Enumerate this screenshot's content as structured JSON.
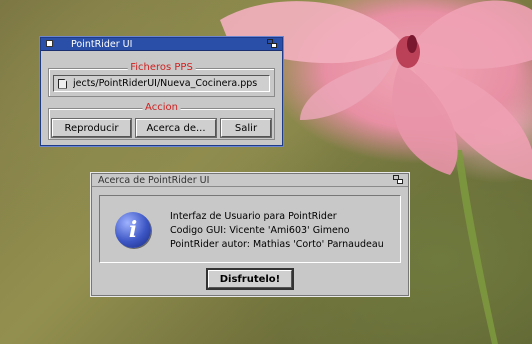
{
  "main_window": {
    "title": "PointRider UI",
    "files_group_label": "Ficheros PPS",
    "file_path": "jects/PointRiderUI/Nueva_Cocinera.pps",
    "actions_group_label": "Accion",
    "buttons": {
      "play": "Reproducir",
      "about": "Acerca de...",
      "quit": "Salir"
    }
  },
  "about_window": {
    "title": "Acerca de PointRider UI",
    "lines": [
      "Interfaz de Usuario para PointRider",
      "Codigo GUI: Vicente 'Ami603' Gimeno",
      "PointRider autor: Mathias 'Corto' Parnaudeau"
    ],
    "ok_button": "Disfrutelo!",
    "info_icon_glyph": "i"
  },
  "colors": {
    "active_title": "#2a4fa8",
    "inactive_title": "#c8c8c8",
    "group_label": "#d02020"
  }
}
